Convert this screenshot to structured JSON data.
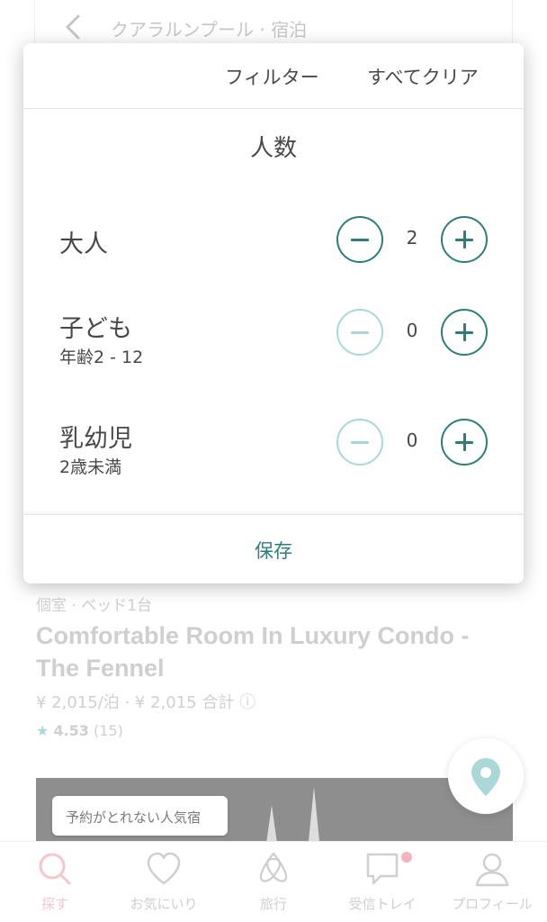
{
  "background": {
    "title": "クアラルンプール · 宿泊",
    "listing": {
      "meta": "個室 · ベッド1台",
      "title_line1": "Comfortable Room In  Luxury Condo -",
      "title_line2": "The Fennel",
      "price": "¥ 2,015/泊 · ¥ 2,015 合計 ⓘ",
      "rating_star": "★",
      "rating_score": "4.53",
      "rating_count": "(15)",
      "photo_badge": "予約がとれない人気宿"
    }
  },
  "modal": {
    "filter_label": "フィルター",
    "clear_all": "すべてクリア",
    "section_title": "人数",
    "rows": [
      {
        "label": "大人",
        "sub": "",
        "value": "2",
        "minus_enabled": true
      },
      {
        "label": "子ども",
        "sub": "年齢2 - 12",
        "value": "0",
        "minus_enabled": false
      },
      {
        "label": "乳幼児",
        "sub": "2歳未満",
        "value": "0",
        "minus_enabled": false
      }
    ],
    "save": "保存"
  },
  "bottom_nav": {
    "items": [
      {
        "label": "探す",
        "icon": "search-icon",
        "active": true
      },
      {
        "label": "お気にいり",
        "icon": "heart-icon"
      },
      {
        "label": "旅行",
        "icon": "airbnb-logo-icon"
      },
      {
        "label": "受信トレイ",
        "icon": "chat-icon",
        "badge": true
      },
      {
        "label": "プロフィール",
        "icon": "profile-icon"
      }
    ]
  },
  "colors": {
    "teal": "#2e7d7b",
    "teal_light": "#a9d8d6",
    "text": "#484848",
    "brand_pink": "#f6c6cf"
  }
}
